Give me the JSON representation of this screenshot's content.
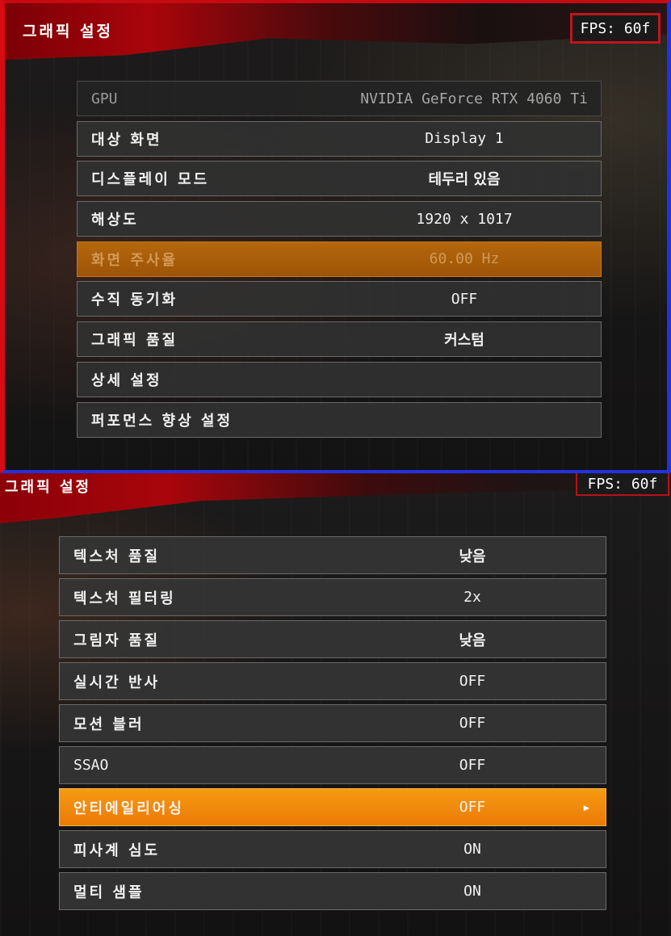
{
  "top": {
    "title": "그래픽 설정",
    "fps": "FPS: 60f",
    "rows": [
      {
        "label": "GPU",
        "value": "NVIDIA GeForce RTX 4060 Ti"
      },
      {
        "label": "대상 화면",
        "value": "Display 1"
      },
      {
        "label": "디스플레이 모드",
        "value": "테두리 있음"
      },
      {
        "label": "해상도",
        "value": "1920 x 1017"
      },
      {
        "label": "화면 주사율",
        "value": "60.00 Hz"
      },
      {
        "label": "수직 동기화",
        "value": "OFF"
      },
      {
        "label": "그래픽 품질",
        "value": "커스텀"
      },
      {
        "label": "상세 설정",
        "value": ""
      },
      {
        "label": "퍼포먼스 향상 설정",
        "value": ""
      }
    ]
  },
  "bottom": {
    "title": "그래픽 설정",
    "fps": "FPS: 60f",
    "rows": [
      {
        "label": "텍스처 품질",
        "value": "낮음"
      },
      {
        "label": "텍스처 필터링",
        "value": "2x"
      },
      {
        "label": "그림자 품질",
        "value": "낮음"
      },
      {
        "label": "실시간 반사",
        "value": "OFF"
      },
      {
        "label": "모션 블러",
        "value": "OFF"
      },
      {
        "label": "SSAO",
        "value": "OFF"
      },
      {
        "label": "안티에일리어싱",
        "value": "OFF",
        "arrow": "▶"
      },
      {
        "label": "피사계 심도",
        "value": "ON"
      },
      {
        "label": "멀티 샘플",
        "value": "ON"
      }
    ]
  },
  "colors": {
    "accent_red": "#d80a14",
    "accent_blue": "#2233dd",
    "selected_orange": "#f08a0c",
    "disabled_orange": "#a85d09"
  }
}
